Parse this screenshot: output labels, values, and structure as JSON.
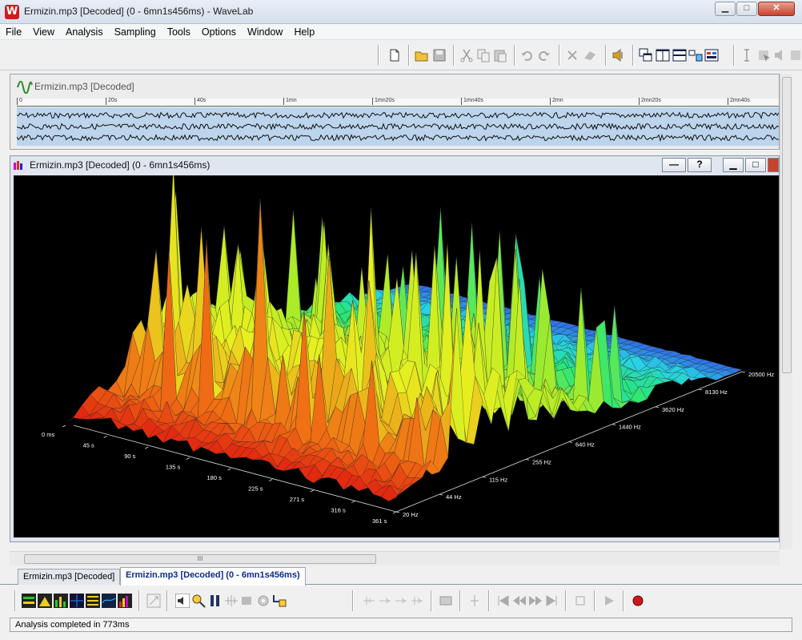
{
  "window": {
    "title": "Ermizin.mp3 [Decoded] (0 - 6mn1s456ms) - WaveLab",
    "logo_letter": "W",
    "min_label": "▁",
    "max_label": "□",
    "close_label": "✕"
  },
  "menu": {
    "items": [
      "File",
      "View",
      "Analysis",
      "Sampling",
      "Tools",
      "Options",
      "Window",
      "Help"
    ]
  },
  "overview": {
    "title": "Ermizin.mp3 [Decoded]",
    "ruler_ticks": [
      "0",
      "20s",
      "40s",
      "1mn",
      "1mn20s",
      "1mn40s",
      "2mn",
      "2mn20s",
      "2mn40s"
    ]
  },
  "analysis": {
    "title": "Ermizin.mp3 [Decoded] (0 - 6mn1s456ms)",
    "btn_line": "—",
    "btn_help": "?",
    "time_labels": [
      "0 ms",
      "45 s",
      "90 s",
      "135 s",
      "180 s",
      "225 s",
      "271 s",
      "316 s",
      "361 s"
    ],
    "freq_labels": [
      "20 Hz",
      "44 Hz",
      "115 Hz",
      "255 Hz",
      "640 Hz",
      "1440 Hz",
      "3620 Hz",
      "8130 Hz",
      "20500 Hz"
    ]
  },
  "hscroll": {
    "grip": "III"
  },
  "tabs": [
    {
      "label": "Ermizin.mp3 [Decoded]",
      "active": false
    },
    {
      "label": "Ermizin.mp3 [Decoded] (0 - 6mn1s456ms)",
      "active": true
    }
  ],
  "status": {
    "text": "Analysis completed in 773ms"
  },
  "colors": {
    "plot_bg": "#000000",
    "accent_red": "#d11a1a",
    "spectrum_low": "#e02010",
    "spectrum_mid": "#e8f020",
    "spectrum_high": "#9040e0"
  },
  "icons": {
    "top_toolbar": [
      "new-file-icon",
      "open-folder-icon",
      "save-icon",
      "cut-icon",
      "copy-icon",
      "paste-icon",
      "undo-icon",
      "redo-icon",
      "delete-icon",
      "eraser-icon",
      "speaker-icon",
      "cascade-icon",
      "tile-icon",
      "tile-horizontal-icon",
      "layout-icon",
      "layout2-icon",
      "cursor-icon",
      "select-icon",
      "speaker2-icon"
    ],
    "bottom_toolbar": [
      "meter1-icon",
      "meter2-icon",
      "meter3-icon",
      "meter4-icon",
      "meter5-icon",
      "meter6-icon",
      "meter7-icon",
      "resize-icon",
      "speaker-play-icon",
      "magnify-icon",
      "pause-icon",
      "dots-icon",
      "cross-icon",
      "stop-icon",
      "goto-start-icon",
      "rewind-icon",
      "forward-icon",
      "goto-end-icon",
      "square-stop-icon",
      "play-icon",
      "record-icon"
    ]
  }
}
